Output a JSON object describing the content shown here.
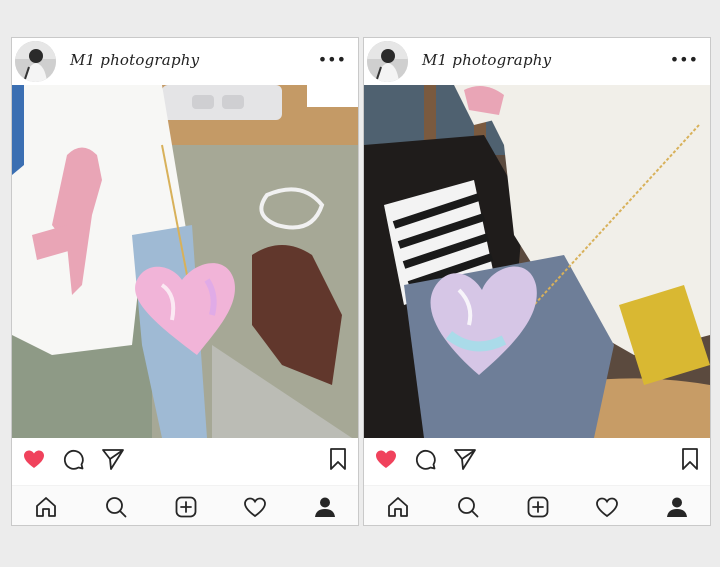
{
  "posts": [
    {
      "username": "M1 photography",
      "more_label": "•••"
    },
    {
      "username": "M1 photography",
      "more_label": "•••"
    }
  ],
  "icons": {
    "more": "more-options-icon",
    "like": "heart-filled-icon",
    "comment": "comment-icon",
    "share": "send-icon",
    "save": "bookmark-icon",
    "home": "home-icon",
    "search": "search-icon",
    "add": "add-post-icon",
    "activity": "heart-outline-icon",
    "profile": "profile-icon"
  },
  "colors": {
    "like": "#f0425c",
    "icon": "#262626"
  }
}
